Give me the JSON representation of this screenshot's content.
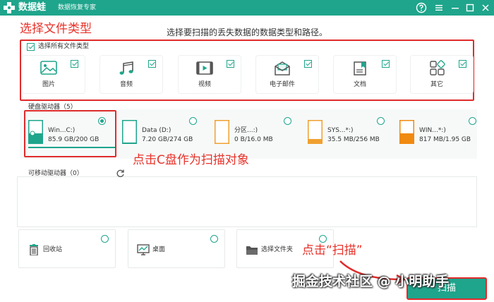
{
  "titlebar": {
    "app_name": "数据蛙",
    "subtitle": "数据恢复专家"
  },
  "annotations": {
    "select_types": "选择文件类型",
    "click_c": "点击C盘作为扫描对象",
    "click_scan": "点击“扫描”"
  },
  "instruction": "选择要扫描的丢失数据的数据类型和路径。",
  "file_types": {
    "select_all_label": "选择所有文件类型",
    "select_all_checked": true,
    "items": [
      {
        "label": "图片",
        "icon": "image-icon",
        "checked": true
      },
      {
        "label": "音频",
        "icon": "music-icon",
        "checked": true
      },
      {
        "label": "视频",
        "icon": "video-icon",
        "checked": true
      },
      {
        "label": "电子邮件",
        "icon": "email-icon",
        "checked": true
      },
      {
        "label": "文档",
        "icon": "document-icon",
        "checked": true
      },
      {
        "label": "其它",
        "icon": "other-icon",
        "checked": true
      }
    ]
  },
  "hard_drives": {
    "title": "硬盘驱动器（5）",
    "items": [
      {
        "name": "Win...C:)",
        "size": "85.9 GB/200 GB",
        "selected": true,
        "fill": 0.43,
        "color": "#1fa58c"
      },
      {
        "name": "Data (D:)",
        "size": "7.20 GB/274 GB",
        "selected": false,
        "fill": 0.03,
        "color": "#1fa58c"
      },
      {
        "name": "分区...:)",
        "size": "0 B/16.0 MB",
        "selected": false,
        "fill": 0.0,
        "color": "#f0a030"
      },
      {
        "name": "SYS...*:)",
        "size": "35.5 MB/256 MB",
        "selected": false,
        "fill": 0.14,
        "color": "#f0a030"
      },
      {
        "name": "WIN...*:)",
        "size": "817 MB/1.95 GB",
        "selected": false,
        "fill": 0.42,
        "color": "#f08a10"
      }
    ]
  },
  "removable": {
    "title": "可移动驱动器（0）"
  },
  "locations": [
    {
      "label": "回收站",
      "icon": "recycle-bin-icon"
    },
    {
      "label": "桌面",
      "icon": "desktop-icon"
    },
    {
      "label": "选择文件夹",
      "icon": "folder-icon"
    }
  ],
  "scan_button": {
    "label": "扫描"
  },
  "watermark": "掘金技术社区 @ 小明助手"
}
